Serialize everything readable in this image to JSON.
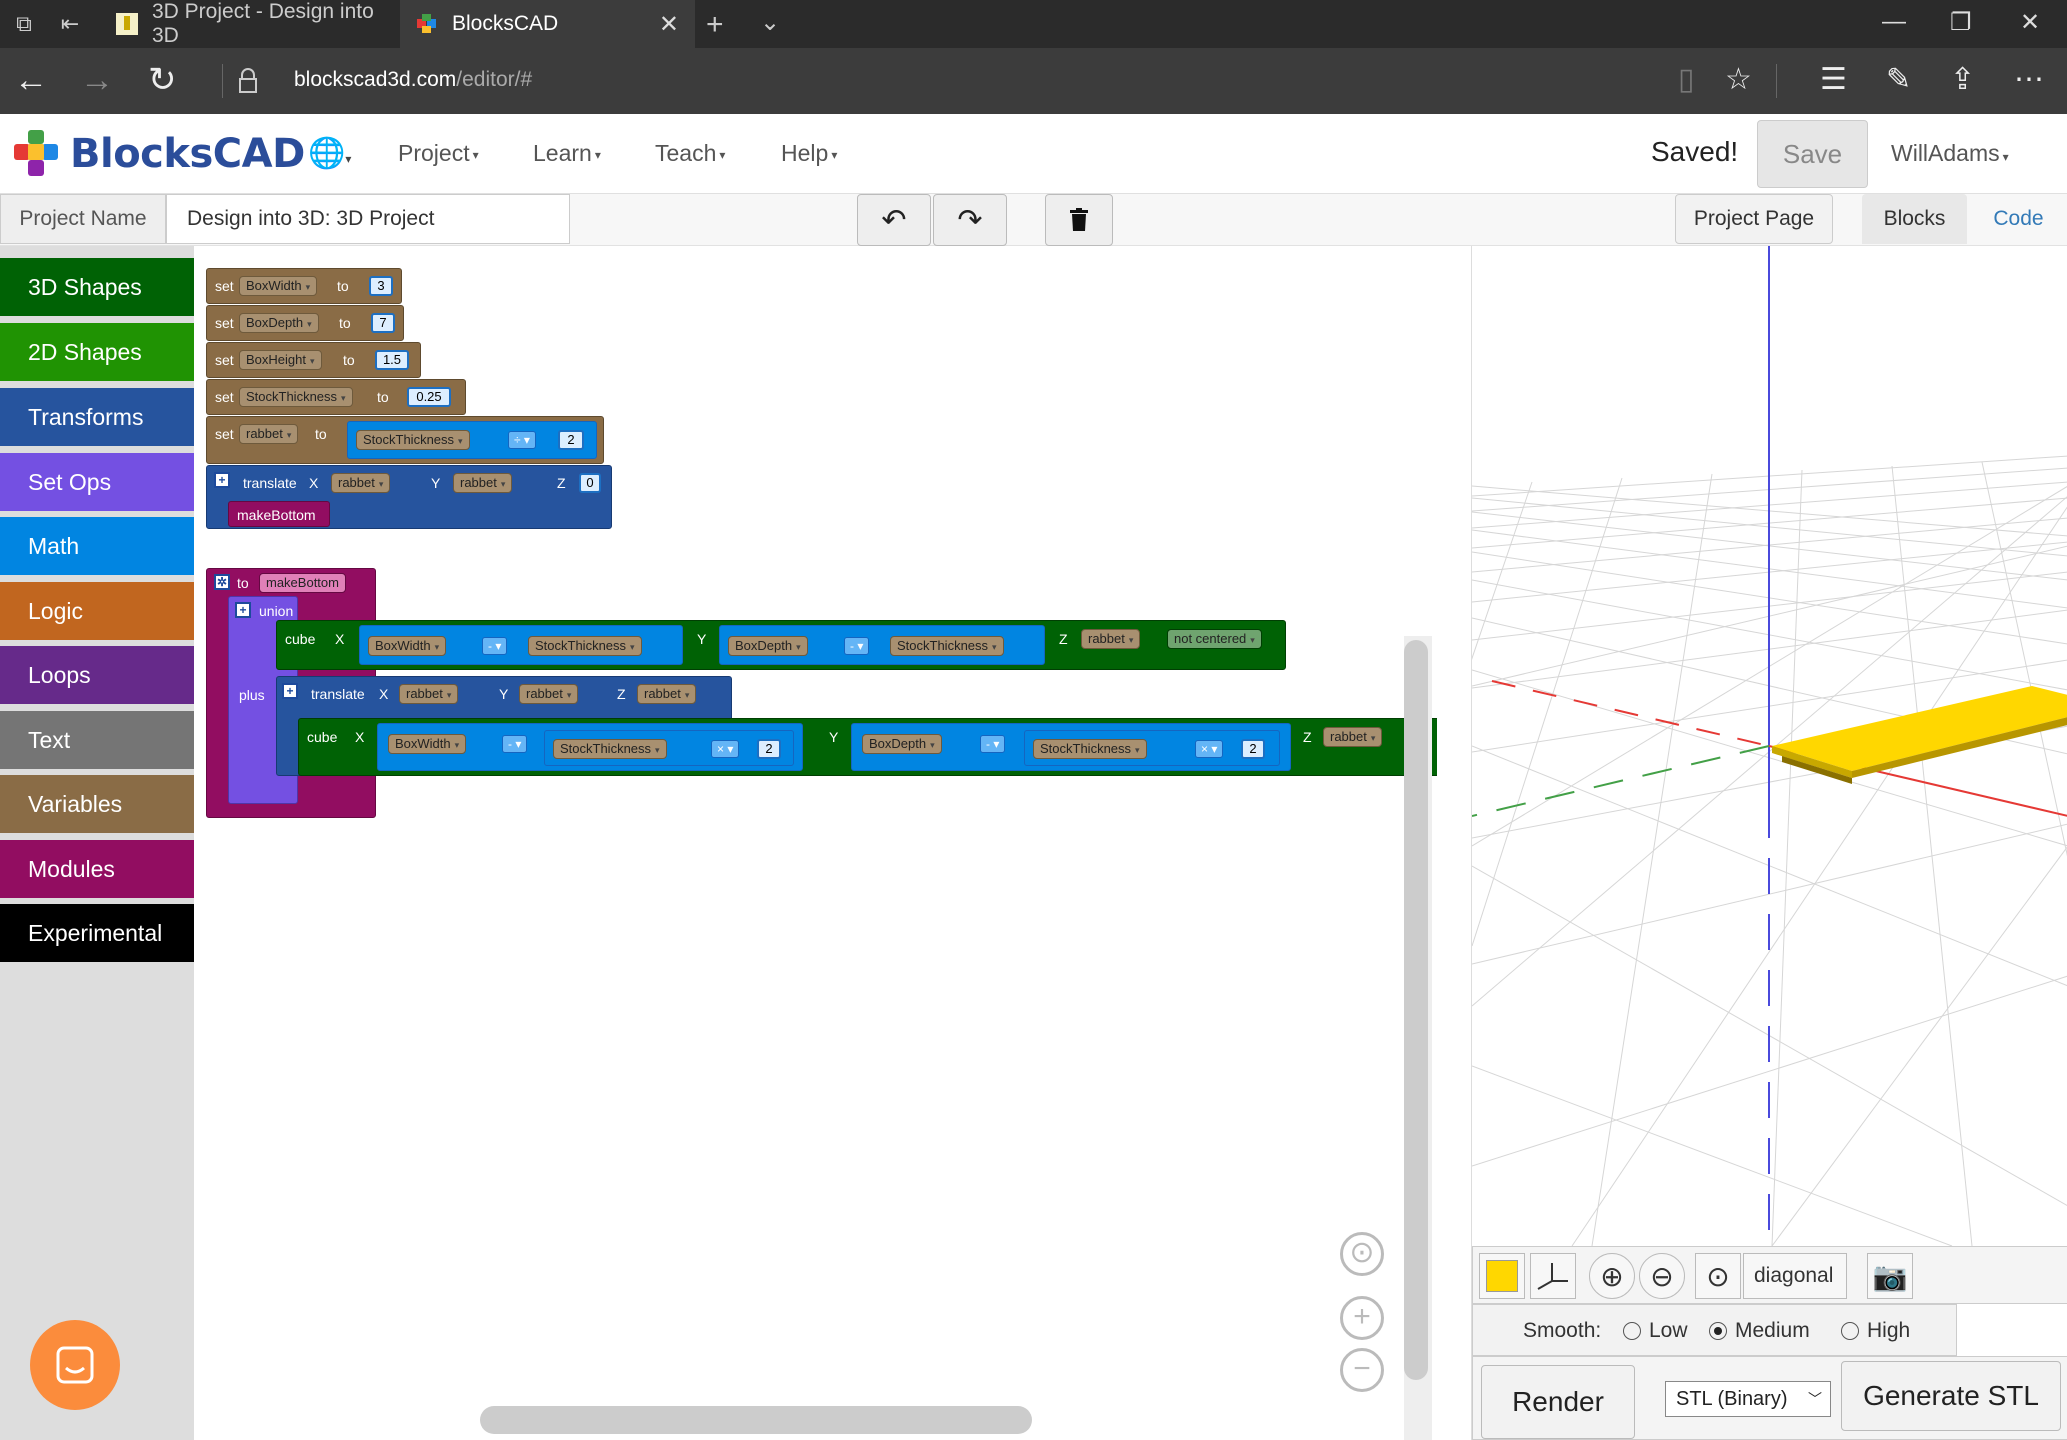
{
  "browser": {
    "tabs": [
      {
        "title": "3D Project - Design into 3D"
      },
      {
        "title": "BlocksCAD"
      }
    ],
    "url_host": "blockscad3d.com",
    "url_path": "/editor/#"
  },
  "navbar": {
    "brand": "BlocksCAD",
    "menu": [
      "Project",
      "Learn",
      "Teach",
      "Help"
    ],
    "status": "Saved!",
    "save_label": "Save",
    "user": "WillAdams"
  },
  "projectbar": {
    "name_label": "Project Name",
    "name_value": "Design into 3D: 3D Project",
    "project_page_label": "Project Page",
    "blocks_tab": "Blocks",
    "code_tab": "Code"
  },
  "toolbox": {
    "categories": [
      {
        "label": "3D Shapes",
        "color": "#006205"
      },
      {
        "label": "2D Shapes",
        "color": "#209303"
      },
      {
        "label": "Transforms",
        "color": "#26549E"
      },
      {
        "label": "Set Ops",
        "color": "#7450E2"
      },
      {
        "label": "Math",
        "color": "#0185E1"
      },
      {
        "label": "Logic",
        "color": "#C1661F"
      },
      {
        "label": "Loops",
        "color": "#662A8A"
      },
      {
        "label": "Text",
        "color": "#757575"
      },
      {
        "label": "Variables",
        "color": "#8A6C46"
      },
      {
        "label": "Modules",
        "color": "#920D61"
      },
      {
        "label": "Experimental",
        "color": "#000000"
      }
    ]
  },
  "blocks": {
    "set_kw": "set",
    "to_kw": "to",
    "vars": [
      {
        "name": "BoxWidth",
        "value": "3"
      },
      {
        "name": "BoxDepth",
        "value": "7"
      },
      {
        "name": "BoxHeight",
        "value": "1.5"
      },
      {
        "name": "StockThickness",
        "value": "0.25"
      }
    ],
    "rabbet": {
      "name": "rabbet",
      "operand": "StockThickness",
      "op": "÷",
      "value": "2"
    },
    "translate_kw": "translate",
    "x_kw": "X",
    "y_kw": "Y",
    "z_kw": "Z",
    "translate1": {
      "x": "rabbet",
      "y": "rabbet",
      "z": "0"
    },
    "call": "makeBottom",
    "proc": {
      "to_kw": "to",
      "name": "makeBottom"
    },
    "union_kw": "union",
    "plus_kw": "plus",
    "cube_kw": "cube",
    "cube1": {
      "x_a": "BoxWidth",
      "x_op": "-",
      "x_b": "StockThickness",
      "y_a": "BoxDepth",
      "y_op": "-",
      "y_b": "StockThickness",
      "z": "rabbet",
      "center": "not centered"
    },
    "translate2": {
      "x": "rabbet",
      "y": "rabbet",
      "z": "rabbet"
    },
    "cube2": {
      "x_a": "BoxWidth",
      "x_op": "-",
      "x_b": "StockThickness",
      "x_mul": "×",
      "x_n": "2",
      "y_a": "BoxDepth",
      "y_op": "-",
      "y_b": "StockThickness",
      "y_mul": "×",
      "y_n": "2",
      "z": "rabbet"
    }
  },
  "viewer": {
    "part_color": "#FFD700",
    "view_mode": "diagonal",
    "smooth_label": "Smooth:",
    "smooth_options": [
      "Low",
      "Medium",
      "High"
    ],
    "smooth_selected": "Medium",
    "render_label": "Render",
    "format_value": "STL (Binary)",
    "generate_label": "Generate STL"
  }
}
